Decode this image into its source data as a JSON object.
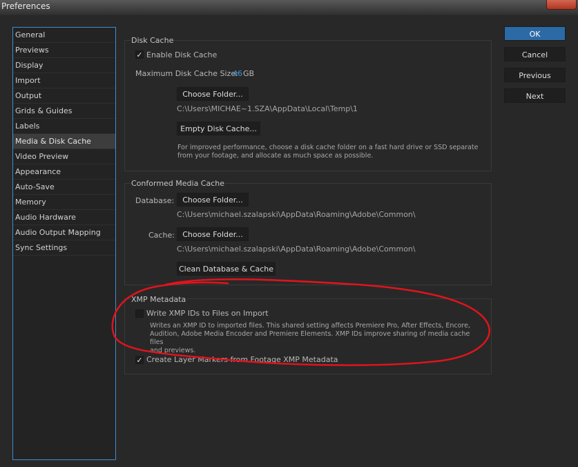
{
  "window": {
    "title": "Preferences"
  },
  "sidebar": {
    "items": [
      {
        "label": "General"
      },
      {
        "label": "Previews"
      },
      {
        "label": "Display"
      },
      {
        "label": "Import"
      },
      {
        "label": "Output"
      },
      {
        "label": "Grids & Guides"
      },
      {
        "label": "Labels"
      },
      {
        "label": "Media & Disk Cache"
      },
      {
        "label": "Video Preview"
      },
      {
        "label": "Appearance"
      },
      {
        "label": "Auto-Save"
      },
      {
        "label": "Memory"
      },
      {
        "label": "Audio Hardware"
      },
      {
        "label": "Audio Output Mapping"
      },
      {
        "label": "Sync Settings"
      }
    ],
    "selected": "Media & Disk Cache"
  },
  "disk_cache": {
    "title": "Disk Cache",
    "enable_label": "Enable Disk Cache",
    "enable_checked": true,
    "max_size_label": "Maximum Disk Cache Size:",
    "max_size_value": "46",
    "max_size_unit": "GB",
    "choose_folder": "Choose Folder...",
    "path": "C:\\Users\\MICHAE~1.SZA\\AppData\\Local\\Temp\\1",
    "empty_cache": "Empty Disk Cache...",
    "help_line1": "For improved performance, choose a disk cache folder on a fast hard drive or SSD separate",
    "help_line2": "from your footage, and allocate as much space as possible."
  },
  "conformed_cache": {
    "title": "Conformed Media Cache",
    "database_label": "Database:",
    "database_button": "Choose Folder...",
    "database_path": "C:\\Users\\michael.szalapski\\AppData\\Roaming\\Adobe\\Common\\",
    "cache_label": "Cache:",
    "cache_button": "Choose Folder...",
    "cache_path": "C:\\Users\\michael.szalapski\\AppData\\Roaming\\Adobe\\Common\\",
    "clean_button": "Clean Database & Cache"
  },
  "xmp": {
    "title": "XMP Metadata",
    "write_ids_label": "Write XMP IDs to Files on Import",
    "write_ids_checked": false,
    "desc_line1": "Writes an XMP ID to imported files. This shared setting affects Premiere Pro, After Effects, Encore,",
    "desc_line2": "Audition, Adobe Media Encoder and Premiere Elements. XMP IDs improve sharing of media cache files",
    "desc_line3": "and previews.",
    "layer_markers_label": "Create Layer Markers from Footage XMP Metadata",
    "layer_markers_checked": true
  },
  "buttons": {
    "ok": "OK",
    "cancel": "Cancel",
    "previous": "Previous",
    "next": "Next"
  },
  "check_glyph": "✓",
  "colors": {
    "accent": "#3e8fcf",
    "annotation": "#e0141c"
  }
}
